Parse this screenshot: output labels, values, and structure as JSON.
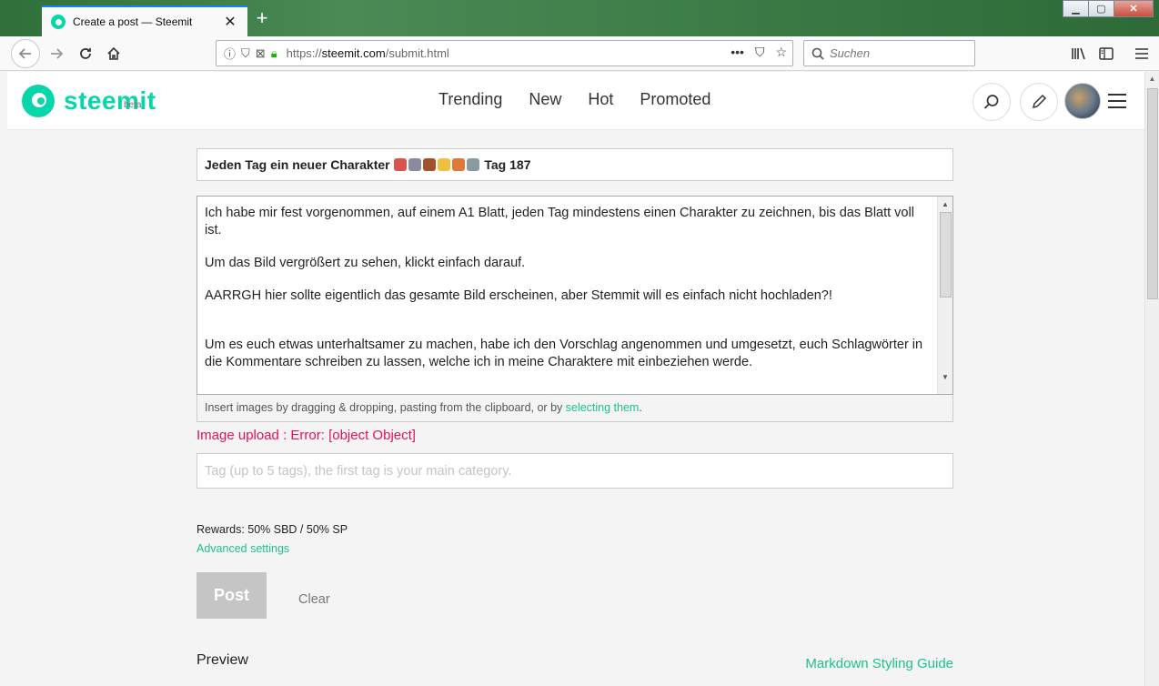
{
  "browser": {
    "tab_title": "Create a post — Steemit",
    "url_domain": "steemit.com",
    "url_full": "https://steemit.com/submit.html",
    "url_prefix": "https://",
    "url_path": "/submit.html",
    "search_placeholder": "Suchen"
  },
  "header": {
    "logo_text": "steemit",
    "logo_badge": "beta",
    "nav": [
      "Trending",
      "New",
      "Hot",
      "Promoted"
    ]
  },
  "editor": {
    "title_text_before": "Jeden Tag ein neuer Charakter",
    "title_text_after": "Tag 187",
    "title_emojis": [
      "#d9534f",
      "#8a8aa0",
      "#a0522d",
      "#f0c040",
      "#e07a3a",
      "#8a9aa0"
    ],
    "body_paragraphs": [
      "Ich habe mir fest vorgenommen, auf einem A1 Blatt, jeden Tag mindestens einen Charakter zu zeichnen, bis das Blatt voll ist.",
      "Um das Bild vergrößert zu sehen, klickt einfach darauf.",
      "AARRGH hier sollte eigentlich das gesamte Bild erscheinen, aber Stemmit will es einfach nicht hochladen?!",
      "Um es euch etwas unterhaltsamer zu machen, habe ich den Vorschlag angenommen und umgesetzt, euch Schlagwörter in die Kommentare schreiben zu lassen, welche ich in meine Charaktere mit einbeziehen werde."
    ],
    "upload_hint": "Insert images by dragging & dropping, pasting from the clipboard, or by ",
    "upload_link": "selecting them",
    "upload_hint_end": ".",
    "error": "Image upload : Error: [object Object]",
    "tag_placeholder": "Tag (up to 5 tags), the first tag is your main category.",
    "rewards": "Rewards: 50% SBD / 50% SP",
    "advanced_settings": "Advanced settings",
    "post_label": "Post",
    "clear_label": "Clear",
    "preview_label": "Preview",
    "markdown_guide": "Markdown Styling Guide"
  },
  "colors": {
    "brand": "#06d6a9",
    "link": "#1fbf8f",
    "error": "#e0115f"
  }
}
